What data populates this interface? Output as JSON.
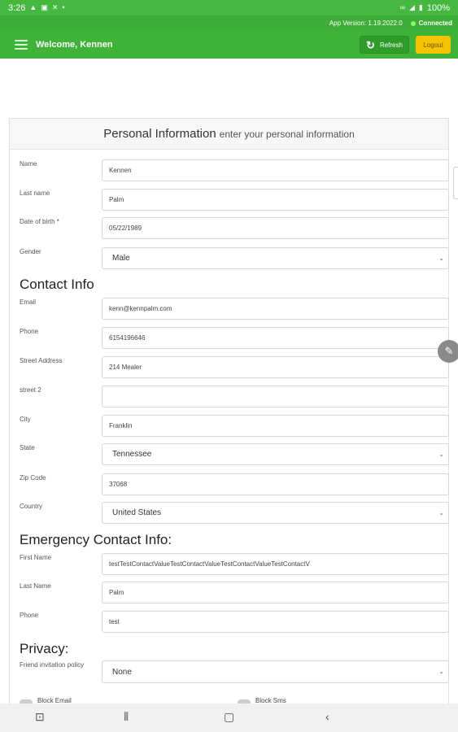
{
  "status": {
    "time": "3:26",
    "battery": "100%",
    "icons_left": [
      "notification-icon",
      "image-icon",
      "x-icon",
      "dot-icon"
    ],
    "icons_right": [
      "link-icon",
      "wifi-icon",
      "battery-icon"
    ]
  },
  "version_bar": {
    "version": "App Version: 1.19.2022.0",
    "connection": "Connected"
  },
  "app_bar": {
    "welcome": "Welcome, Kennen",
    "refresh_label": "Refresh",
    "logout_label": "Logout"
  },
  "card": {
    "title": "Personal Information",
    "subtitle": "enter your personal information"
  },
  "personal": {
    "name": {
      "label": "Name",
      "value": "Kennen"
    },
    "last_name": {
      "label": "Last name",
      "value": "Palm"
    },
    "dob": {
      "label": "Date of birth *",
      "value": "05/22/1989"
    },
    "gender": {
      "label": "Gender",
      "value": "Male"
    }
  },
  "contact": {
    "heading": "Contact Info",
    "email": {
      "label": "Email",
      "value": "kenn@kennpalm.com"
    },
    "phone": {
      "label": "Phone",
      "value": "6154196646"
    },
    "street": {
      "label": "Street Address",
      "value": "214 Mealer"
    },
    "street2": {
      "label": "street 2",
      "value": ""
    },
    "city": {
      "label": "City",
      "value": "Franklin"
    },
    "state": {
      "label": "State",
      "value": "Tennessee"
    },
    "zip": {
      "label": "Zip Code",
      "value": "37068"
    },
    "country": {
      "label": "Country",
      "value": "United States"
    }
  },
  "emergency": {
    "heading": "Emergency Contact Info:",
    "first_name": {
      "label": "First Name",
      "value": "testTestContactValueTestContactValueTestContactValueTestContactV"
    },
    "last_name": {
      "label": "Last Name",
      "value": "Palm"
    },
    "phone": {
      "label": "Phone",
      "value": "test"
    }
  },
  "privacy": {
    "heading": "Privacy:",
    "friend_invitation": {
      "label": "Friend invitation policy",
      "value": "None"
    },
    "block_email": "Block Email",
    "block_sms": "Block Sms"
  },
  "colors": {
    "status_bar": "#46b83f",
    "app_bar": "#3fb337",
    "refresh_button": "#2f9c2a",
    "logout_button": "#f5c400"
  }
}
